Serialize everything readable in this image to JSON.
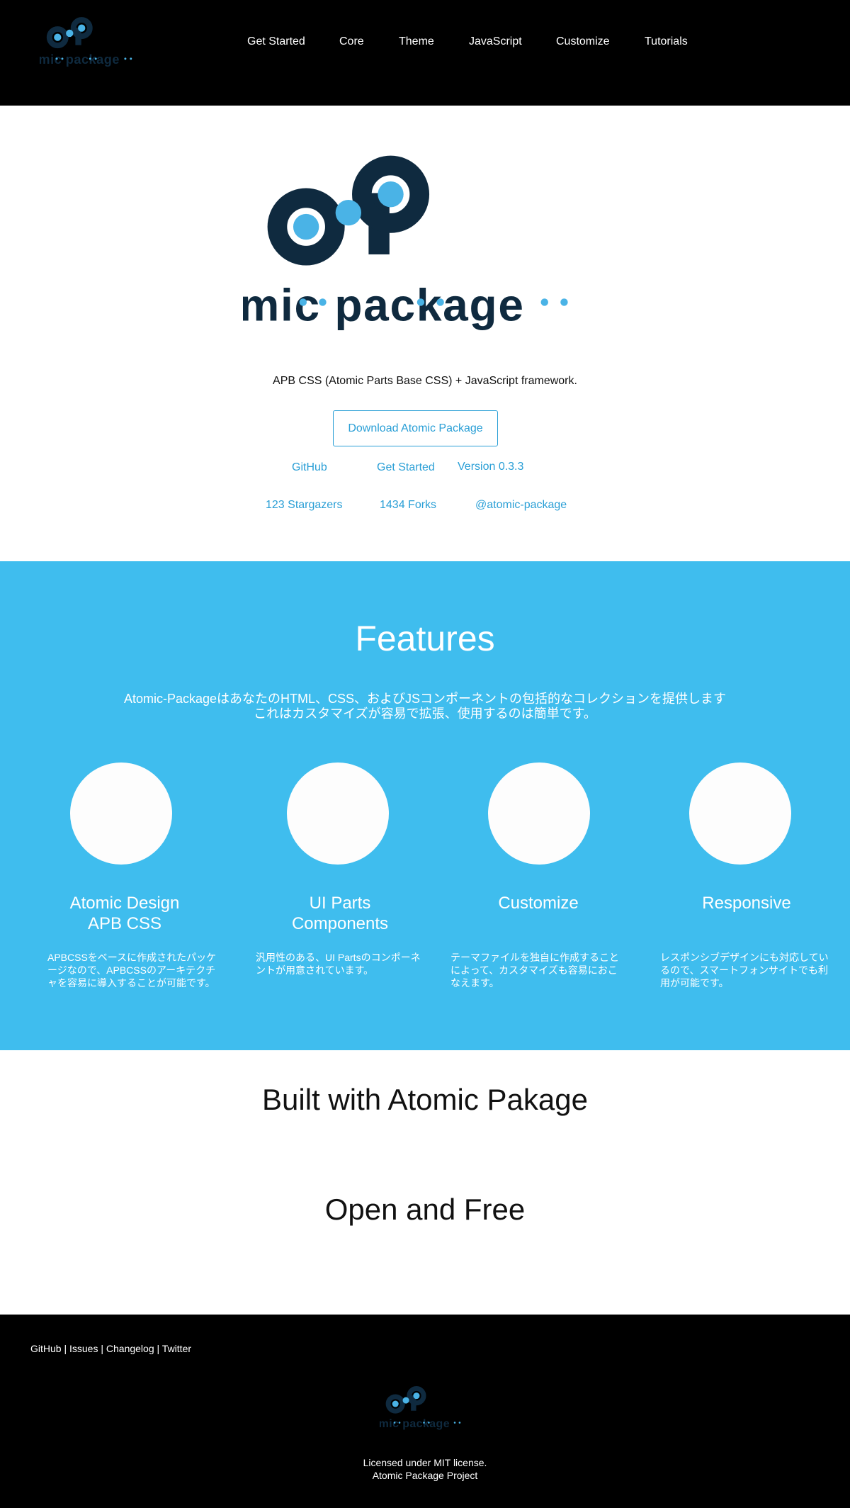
{
  "brand": {
    "name": "atomic package",
    "color_dark": "#0f2a3f",
    "color_light": "#4ab3e6",
    "accent": "#2a9fd6",
    "features_bg": "#3fbdee"
  },
  "nav": [
    "Get Started",
    "Core",
    "Theme",
    "JavaScript",
    "Customize",
    "Tutorials"
  ],
  "hero": {
    "tagline": "APB CSS (Atomic Parts Base CSS) + JavaScript framework.",
    "download_label": "Download Atomic Package",
    "links": {
      "github": "GitHub",
      "get_started": "Get Started",
      "version": "Version 0.3.3"
    },
    "stats": {
      "stargazers": "123 Stargazers",
      "forks": "1434 Forks",
      "twitter": "@atomic-package"
    }
  },
  "features": {
    "title": "Features",
    "lead": [
      "Atomic-PackageはあなたのHTML、CSS、およびJSコンポーネントの包括的なコレクションを提供します",
      "これはカスタマイズが容易で拡張、使用するのは簡単です。"
    ],
    "items": [
      {
        "title": [
          "Atomic Design",
          "APB CSS"
        ],
        "desc": "APBCSSをベースに作成されたパッケージなので、APBCSSのアーキテクチャを容易に導入することが可能です。"
      },
      {
        "title": [
          "UI Parts",
          "Components"
        ],
        "desc": "汎用性のある、UI Partsのコンポーネントが用意されています。"
      },
      {
        "title": [
          "Customize"
        ],
        "desc": "テーマファイルを独自に作成することによって、カスタマイズも容易におこなえます。"
      },
      {
        "title": [
          "Responsive"
        ],
        "desc": "レスポンシブデザインにも対応しているので、スマートフォンサイトでも利用が可能です。"
      }
    ]
  },
  "built_title": "Built with Atomic Pakage",
  "open_title": "Open and Free",
  "footer": {
    "links": [
      "GitHub",
      "Issues",
      "Changelog",
      "Twitter"
    ],
    "separator": " | ",
    "license": [
      "Licensed under MIT license.",
      "Atomic Package Project"
    ]
  }
}
